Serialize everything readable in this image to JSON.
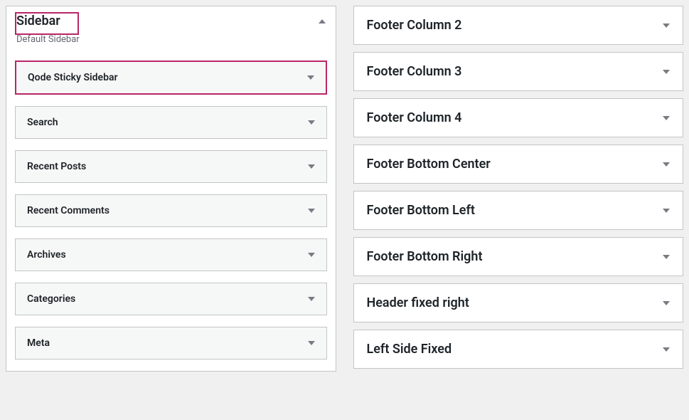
{
  "left": {
    "panel_title": "Sidebar",
    "panel_desc": "Default Sidebar",
    "widgets": [
      {
        "label": "Qode Sticky Sidebar"
      },
      {
        "label": "Search"
      },
      {
        "label": "Recent Posts"
      },
      {
        "label": "Recent Comments"
      },
      {
        "label": "Archives"
      },
      {
        "label": "Categories"
      },
      {
        "label": "Meta"
      }
    ]
  },
  "right": {
    "areas": [
      {
        "label": "Footer Column 2"
      },
      {
        "label": "Footer Column 3"
      },
      {
        "label": "Footer Column 4"
      },
      {
        "label": "Footer Bottom Center"
      },
      {
        "label": "Footer Bottom Left"
      },
      {
        "label": "Footer Bottom Right"
      },
      {
        "label": "Header fixed right"
      },
      {
        "label": "Left Side Fixed"
      }
    ]
  }
}
